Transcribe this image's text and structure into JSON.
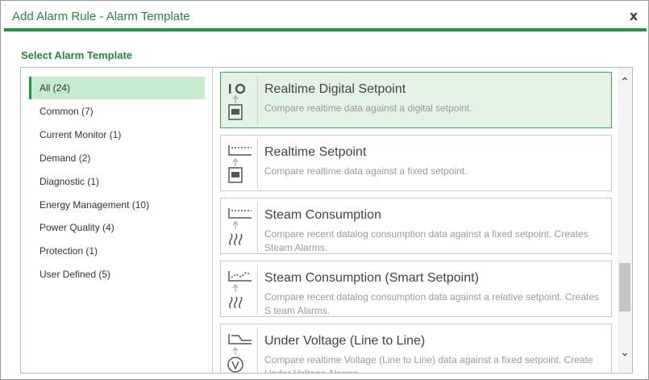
{
  "dialog": {
    "title": "Add Alarm Rule - Alarm Template",
    "close_label": "x",
    "section_label": "Select Alarm Template"
  },
  "categories": [
    {
      "label": "All (24)",
      "active": true
    },
    {
      "label": "Common (7)"
    },
    {
      "label": "Current Monitor (1)"
    },
    {
      "label": "Demand (2)"
    },
    {
      "label": "Diagnostic (1)"
    },
    {
      "label": "Energy Management (10)"
    },
    {
      "label": "Power Quality (4)"
    },
    {
      "label": "Protection (1)"
    },
    {
      "label": "User Defined (5)"
    }
  ],
  "templates": [
    {
      "title": "Realtime Digital Setpoint",
      "description": "Compare realtime data against a digital setpoint.",
      "icon": "digital-setpoint-icon",
      "selected": true
    },
    {
      "title": "Realtime Setpoint",
      "description": "Compare realtime data against a fixed setpoint.",
      "icon": "fixed-setpoint-icon"
    },
    {
      "title": "Steam Consumption",
      "description": "Compare recent datalog consumption data against a fixed setpoint. Creates Steam Alarms.",
      "icon": "steam-fixed-icon"
    },
    {
      "title": "Steam Consumption (Smart Setpoint)",
      "description": "Compare recent datalog consumption data against a relative setpoint. Creates S team Alarms.",
      "icon": "steam-smart-icon"
    },
    {
      "title": "Under Voltage (Line to Line)",
      "description": "Compare realtime Voltage (Line to Line) data against a fixed setpoint. Create Under Voltage Alarms.",
      "icon": "voltage-icon"
    }
  ],
  "scrollbar": {
    "up_glyph": "⌃",
    "down_glyph": "⌄"
  },
  "colors": {
    "accent": "#1a9a3a",
    "selected_bg": "#e2f3e5",
    "active_category_bg": "#c6eccf"
  }
}
